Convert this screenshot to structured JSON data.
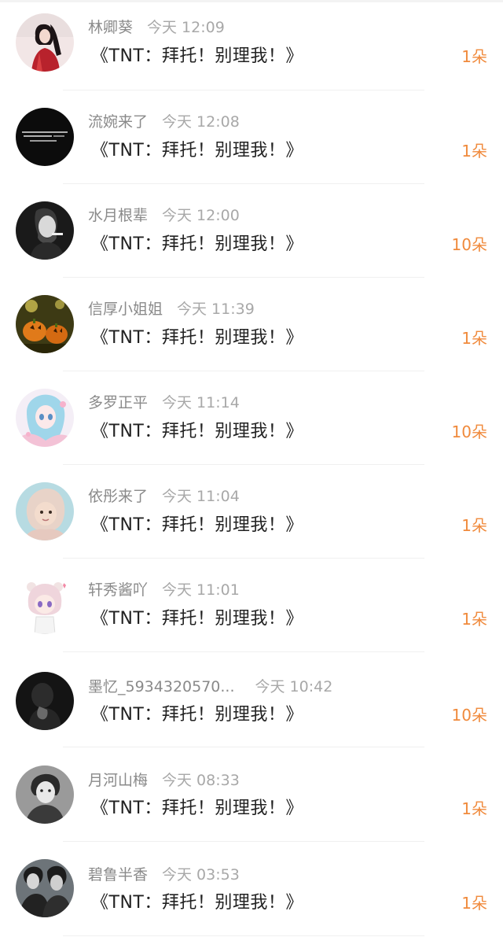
{
  "colors": {
    "gift_text": "#f08a3c",
    "username_text": "#8a8a8a",
    "time_text": "#a8a8a8",
    "content_text": "#222222"
  },
  "items": [
    {
      "username": "林卿葵",
      "time": "今天 12:09",
      "content": "《TNT：拜托！别理我！》",
      "gift": "1朵",
      "avatar_icon": "avatar-woman-red-dress"
    },
    {
      "username": "流婉来了",
      "time": "今天 12:08",
      "content": "《TNT：拜托！别理我！》",
      "gift": "1朵",
      "avatar_icon": "avatar-black-text"
    },
    {
      "username": "水月根辈",
      "time": "今天 12:00",
      "content": "《TNT：拜托！别理我！》",
      "gift": "10朵",
      "avatar_icon": "avatar-man-smoking"
    },
    {
      "username": "信厚小姐姐",
      "time": "今天 11:39",
      "content": "《TNT：拜托！别理我！》",
      "gift": "1朵",
      "avatar_icon": "avatar-pumpkins"
    },
    {
      "username": "多罗正平",
      "time": "今天 11:14",
      "content": "《TNT：拜托！别理我！》",
      "gift": "10朵",
      "avatar_icon": "avatar-anime-girl"
    },
    {
      "username": "依彤来了",
      "time": "今天 11:04",
      "content": "《TNT：拜托！别理我！》",
      "gift": "1朵",
      "avatar_icon": "avatar-baby"
    },
    {
      "username": "轩秀酱吖",
      "time": "今天 11:01",
      "content": "《TNT：拜托！别理我！》",
      "gift": "1朵",
      "avatar_icon": "avatar-chibi-girl"
    },
    {
      "username": "墨忆_5934320570...",
      "time": "今天 10:42",
      "content": "《TNT：拜托！别理我！》",
      "gift": "10朵",
      "avatar_icon": "avatar-dark-person"
    },
    {
      "username": "月河山梅",
      "time": "今天 08:33",
      "content": "《TNT：拜托！别理我！》",
      "gift": "1朵",
      "avatar_icon": "avatar-man-bw"
    },
    {
      "username": "碧鲁半香",
      "time": "今天 03:53",
      "content": "《TNT：拜托！别理我！》",
      "gift": "1朵",
      "avatar_icon": "avatar-couple-dark"
    }
  ]
}
